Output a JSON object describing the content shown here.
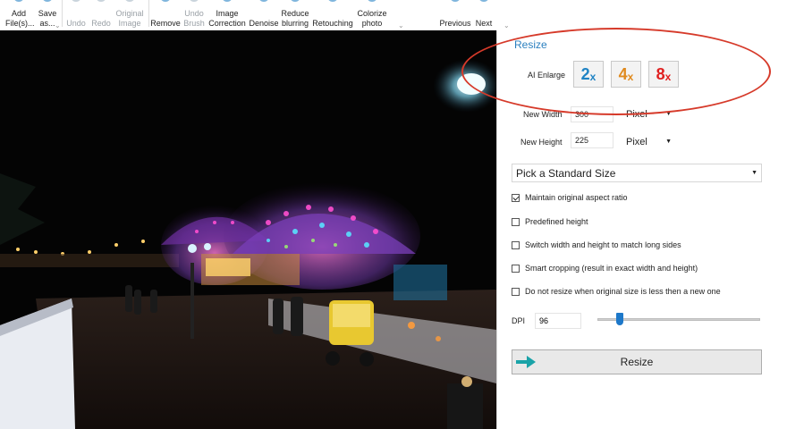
{
  "toolbar": {
    "add_files": "Add\nFile(s)...",
    "save_as": "Save\nas...",
    "undo": "Undo",
    "redo": "Redo",
    "original_image": "Original\nImage",
    "remove": "Remove",
    "undo_brush": "Undo\nBrush",
    "image_correction": "Image\nCorrection",
    "denoise": "Denoise",
    "reduce_blurring": "Reduce\nblurring",
    "retouching": "Retouching",
    "colorize_photo": "Colorize\nphoto",
    "previous": "Previous",
    "next": "Next"
  },
  "panel": {
    "title": "Resize",
    "ai_enlarge_label": "AI Enlarge",
    "enlarge": [
      {
        "num": "2",
        "suffix": "x",
        "color": "#1f83c4"
      },
      {
        "num": "4",
        "suffix": "x",
        "color": "#e08a1e"
      },
      {
        "num": "8",
        "suffix": "x",
        "color": "#e02020"
      }
    ],
    "new_width_label": "New Width",
    "new_width_value": "300",
    "new_width_unit": "Pixel",
    "new_height_label": "New Height",
    "new_height_value": "225",
    "new_height_unit": "Pixel",
    "standard_size": "Pick a Standard Size",
    "options": [
      {
        "label": "Maintain original aspect ratio",
        "checked": true
      },
      {
        "label": "Predefined height",
        "checked": false
      },
      {
        "label": "Switch width and height to match long sides",
        "checked": false
      },
      {
        "label": "Smart cropping (result in exact width and height)",
        "checked": false
      },
      {
        "label": "Do not resize when original size is less then a new one",
        "checked": false
      }
    ],
    "dpi_label": "DPI",
    "dpi_value": "96",
    "dpi_slider_fraction": 0.12,
    "resize_button": "Resize"
  },
  "colors": {
    "accent": "#2a7fbf",
    "annotation": "#d63a2a",
    "arrow": "#1aa3a8"
  },
  "icons": [
    "arrow-right-icon",
    "chevron-down-icon",
    "checkbox-icon"
  ]
}
